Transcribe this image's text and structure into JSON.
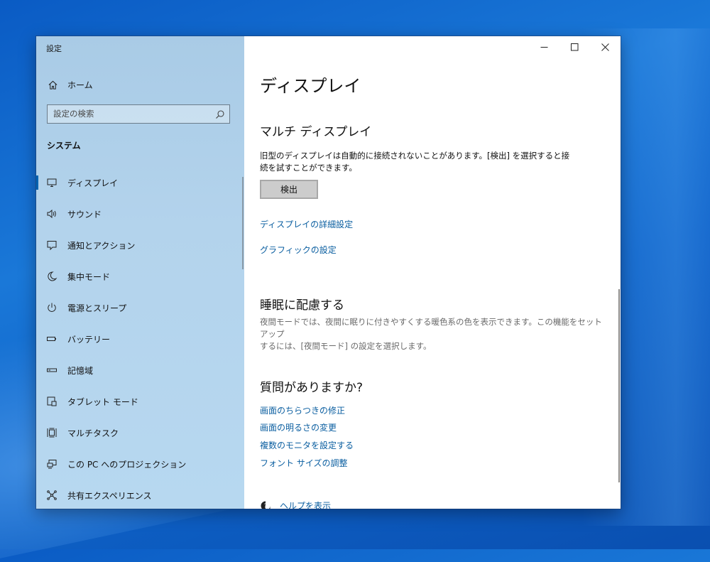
{
  "window": {
    "title": "設定"
  },
  "sidebar": {
    "home_label": "ホーム",
    "search_placeholder": "設定の検索",
    "section": "システム",
    "items": [
      {
        "label": "ディスプレイ",
        "icon": "monitor-icon",
        "active": true
      },
      {
        "label": "サウンド",
        "icon": "speaker-icon"
      },
      {
        "label": "通知とアクション",
        "icon": "notification-icon"
      },
      {
        "label": "集中モード",
        "icon": "moon-icon"
      },
      {
        "label": "電源とスリープ",
        "icon": "power-icon"
      },
      {
        "label": "バッテリー",
        "icon": "battery-icon"
      },
      {
        "label": "記憶域",
        "icon": "storage-icon"
      },
      {
        "label": "タブレット モード",
        "icon": "tablet-mode-icon"
      },
      {
        "label": "マルチタスク",
        "icon": "multitask-icon"
      },
      {
        "label": "この PC へのプロジェクション",
        "icon": "projection-icon"
      },
      {
        "label": "共有エクスペリエンス",
        "icon": "shared-experiences-icon"
      }
    ]
  },
  "main": {
    "page_title": "ディスプレイ",
    "multi_display": {
      "heading": "マルチ ディスプレイ",
      "description_line1": "旧型のディスプレイは自動的に接続されないことがあります。[検出] を選択すると接",
      "description_line2": "続を試すことができます。",
      "detect_button": "検出"
    },
    "links": {
      "advanced_display": "ディスプレイの詳細設定",
      "graphics_settings": "グラフィックの設定"
    },
    "sleep": {
      "heading": "睡眠に配慮する",
      "description_line1": "夜間モードでは、夜間に眠りに付きやすくする暖色系の色を表示できます。この機能をセットアップ",
      "description_line2": "するには、[夜間モード] の設定を選択します。"
    },
    "questions": {
      "heading": "質問がありますか?",
      "links": [
        "画面のちらつきの修正",
        "画面の明るさの変更",
        "複数のモニタを設定する",
        "フォント サイズの調整"
      ]
    },
    "help_link": "ヘルプを表示"
  },
  "colors": {
    "accent": "#0063b1",
    "link": "#0a5ea0",
    "sidebar_bg": "#b3d3ec"
  }
}
